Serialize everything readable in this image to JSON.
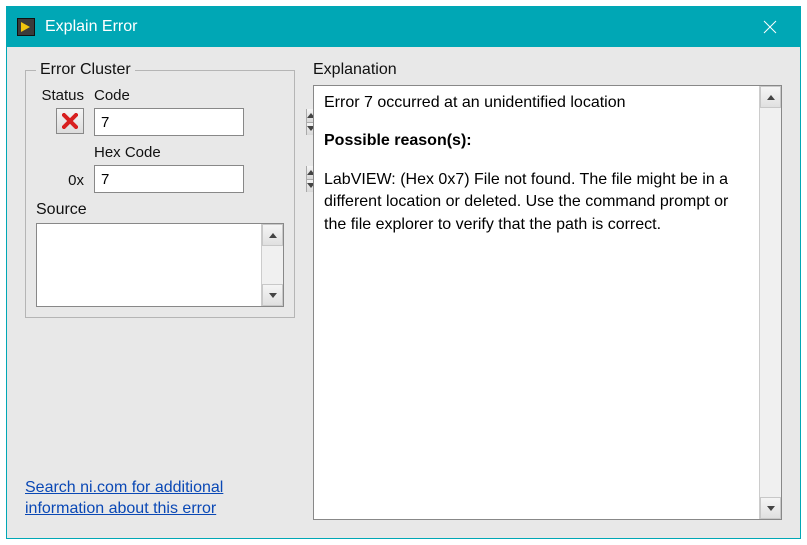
{
  "window": {
    "title": "Explain Error"
  },
  "cluster": {
    "legend": "Error Cluster",
    "status_label": "Status",
    "code_label": "Code",
    "code_value": "7",
    "hex_label": "Hex Code",
    "hex_prefix": "0x",
    "hex_value": "7",
    "source_label": "Source",
    "source_value": ""
  },
  "link": {
    "text": "Search ni.com for additional information about this error"
  },
  "explanation": {
    "label": "Explanation",
    "error_line": "Error 7 occurred at an unidentified location",
    "reasons_heading": "Possible reason(s):",
    "body": "LabVIEW: (Hex 0x7) File not found. The file might be in a different location or deleted. Use the command prompt or the file explorer to verify that the path is correct."
  },
  "colors": {
    "titlebar": "#00a7b5",
    "link": "#0a48b5",
    "error_x": "#d82020"
  }
}
